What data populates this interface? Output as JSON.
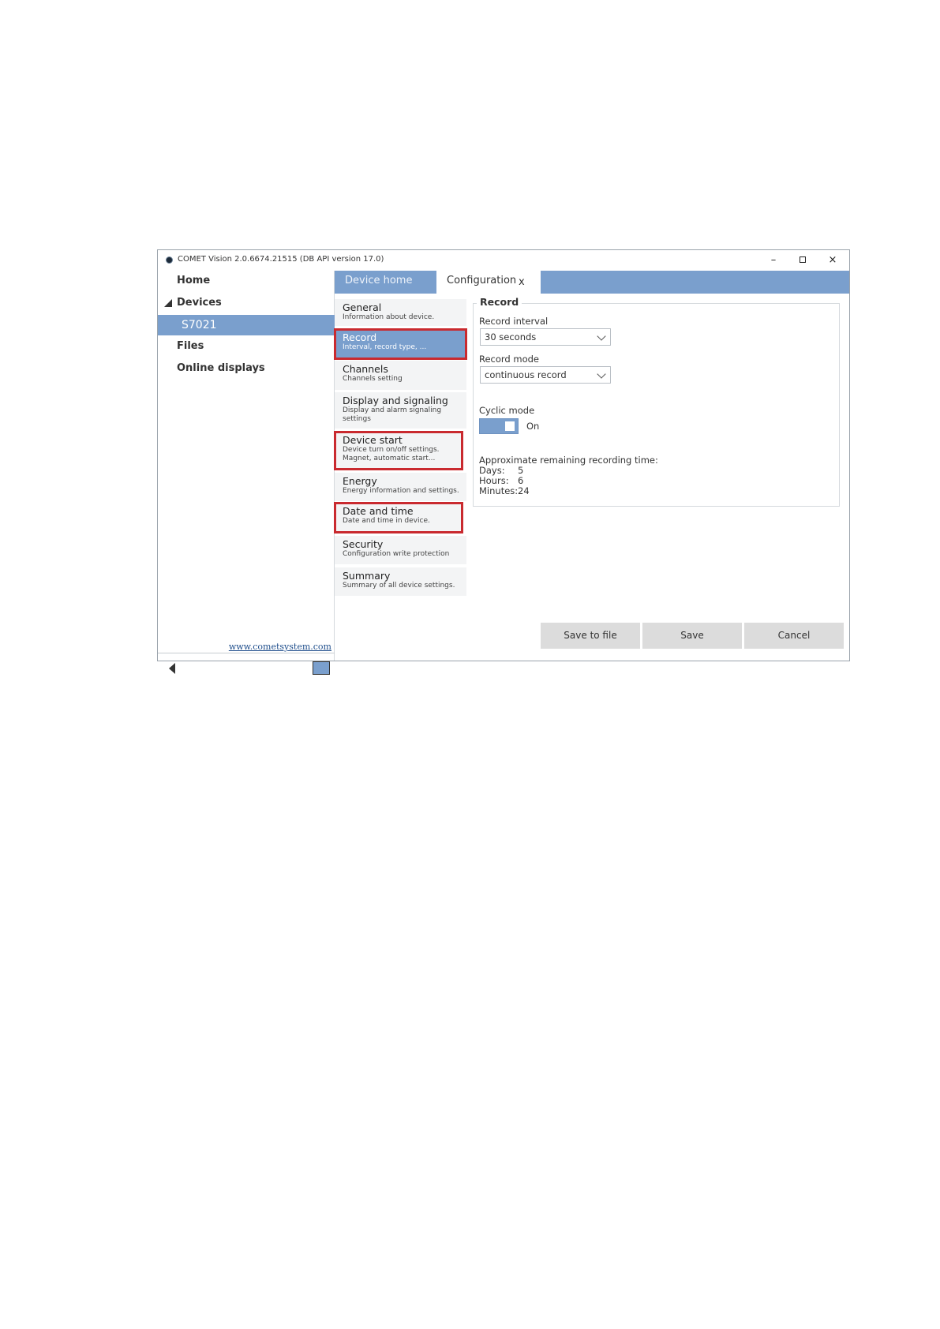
{
  "window": {
    "title": "COMET Vision 2.0.6674.21515 (DB API version 17.0)",
    "controls": {
      "minimize": "–",
      "close": "×"
    }
  },
  "sidebar": {
    "items": [
      {
        "label": "Home"
      },
      {
        "label": "Devices"
      },
      {
        "label": "S7021"
      },
      {
        "label": "Files"
      },
      {
        "label": "Online displays"
      }
    ],
    "link": "www.cometsystem.com"
  },
  "tabs": [
    {
      "label": "Device home"
    },
    {
      "label": "Configuration",
      "close": "x"
    }
  ],
  "menu": [
    {
      "title": "General",
      "subtitle": "Information about device."
    },
    {
      "title": "Record",
      "subtitle": "Interval, record type, ..."
    },
    {
      "title": "Channels",
      "subtitle": "Channels setting"
    },
    {
      "title": "Display and signaling",
      "subtitle": "Display and alarm signaling",
      "subtitle2": "settings"
    },
    {
      "title": "Device start",
      "subtitle": "Device turn on/off settings.",
      "subtitle2": "Magnet, automatic start..."
    },
    {
      "title": "Energy",
      "subtitle": "Energy information and settings."
    },
    {
      "title": "Date and time",
      "subtitle": "Date and time in device."
    },
    {
      "title": "Security",
      "subtitle": "Configuration write protection"
    },
    {
      "title": "Summary",
      "subtitle": "Summary of all device settings."
    }
  ],
  "record": {
    "group_title": "Record",
    "interval_label": "Record interval",
    "interval_value": "30 seconds",
    "mode_label": "Record mode",
    "mode_value": "continuous record",
    "cyclic_label": "Cyclic mode",
    "cyclic_state": "On",
    "remaining_label": "Approximate remaining recording time:",
    "days_label": "Days:",
    "days_value": "5",
    "hours_label": "Hours:",
    "hours_value": "6",
    "minutes_label": "Minutes:",
    "minutes_value": "24"
  },
  "buttons": {
    "save_to_file": "Save to file",
    "save": "Save",
    "cancel": "Cancel"
  },
  "colors": {
    "accent": "#7a9fcd",
    "highlight": "#c92a2f"
  }
}
